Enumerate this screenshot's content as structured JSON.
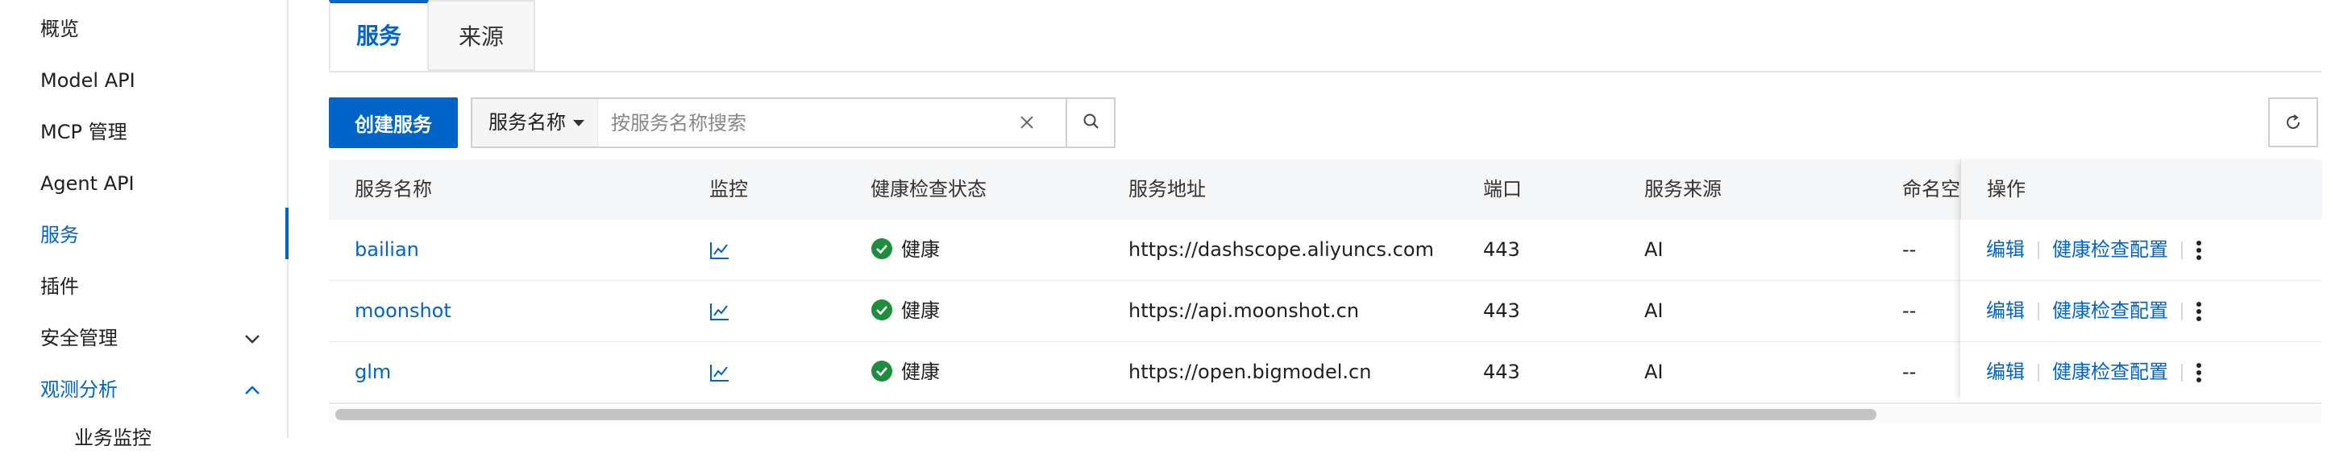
{
  "sidebar": {
    "items": [
      {
        "label": "概览"
      },
      {
        "label": "Model API"
      },
      {
        "label": "MCP 管理"
      },
      {
        "label": "Agent API"
      },
      {
        "label": "服务",
        "active": true
      },
      {
        "label": "插件"
      },
      {
        "label": "安全管理",
        "chevron": "chevron-down"
      },
      {
        "label": "观测分析",
        "chevron": "chevron-up"
      }
    ],
    "sub_item": "业务监控"
  },
  "tabs": [
    {
      "label": "服务",
      "active": true
    },
    {
      "label": "来源"
    }
  ],
  "toolbar": {
    "create_label": "创建服务",
    "search_field_select": "服务名称",
    "search_placeholder": "按服务名称搜索"
  },
  "table": {
    "columns": [
      "服务名称",
      "监控",
      "健康检查状态",
      "服务地址",
      "端口",
      "服务来源",
      "命名空间",
      "操作"
    ],
    "rows": [
      {
        "name": "bailian",
        "health": "健康",
        "address": "https://dashscope.aliyuncs.com",
        "port": "443",
        "source": "AI",
        "namespace": "--"
      },
      {
        "name": "moonshot",
        "health": "健康",
        "address": "https://api.moonshot.cn",
        "port": "443",
        "source": "AI",
        "namespace": "--"
      },
      {
        "name": "glm",
        "health": "健康",
        "address": "https://open.bigmodel.cn",
        "port": "443",
        "source": "AI",
        "namespace": "--"
      }
    ],
    "actions": {
      "edit": "编辑",
      "health_config": "健康检查配置"
    }
  },
  "colors": {
    "primary": "#0064c8",
    "success": "#1e8e3e"
  }
}
